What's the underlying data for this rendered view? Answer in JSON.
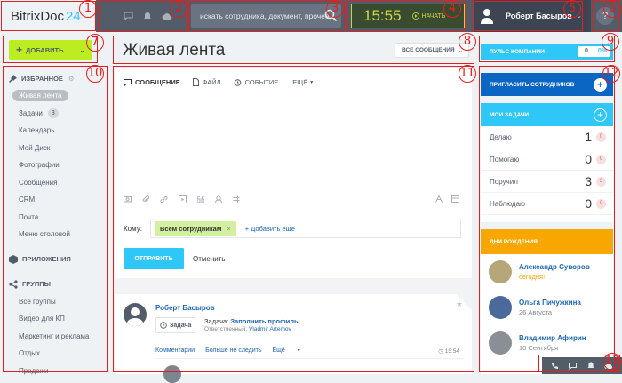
{
  "header": {
    "logo_main": "BitrixDoc",
    "logo_num": "24",
    "search_placeholder": "искать сотрудника, документ, прочее...",
    "clock_time": "15:55",
    "clock_start": "НАЧАТЬ",
    "user_name": "Роберт Басыров",
    "help": "?"
  },
  "add_button": {
    "label": "ДОБАВИТЬ",
    "plus": "+",
    "chevron": "⌄"
  },
  "sidebar": {
    "favorites_title": "ИЗБРАННОЕ",
    "favorites": [
      {
        "label": "Живая лента"
      },
      {
        "label": "Задачи",
        "badge": "3"
      },
      {
        "label": "Календарь"
      },
      {
        "label": "Мой Диск"
      },
      {
        "label": "Фотографии"
      },
      {
        "label": "Сообщения"
      },
      {
        "label": "CRM"
      },
      {
        "label": "Почта"
      },
      {
        "label": "Меню столовой"
      }
    ],
    "apps_title": "ПРИЛОЖЕНИЯ",
    "groups_title": "ГРУППЫ",
    "groups": [
      {
        "label": "Все группы"
      },
      {
        "label": "Видео для КП"
      },
      {
        "label": "Маркетинг и реклама"
      },
      {
        "label": "Отдых"
      },
      {
        "label": "Продажи"
      }
    ]
  },
  "main": {
    "title": "Живая лента",
    "filter": "ВСЕ СООБЩЕНИЯ",
    "filter_chevron": "⌄",
    "tabs": {
      "message": "СООБЩЕНИЕ",
      "file": "ФАЙЛ",
      "event": "СОБЫТИЕ",
      "more": "ЕЩЁ"
    },
    "to_label": "Кому:",
    "recipient": "Всем сотрудникам",
    "recipient_remove": "×",
    "add_more": "+ Добавить еще",
    "send": "ОТПРАВИТЬ",
    "cancel": "Отменить",
    "post": {
      "author": "Роберт Басыров",
      "type": "Задача",
      "task_prefix": "Задача:",
      "task_link": "Заполнить профиль",
      "resp_prefix": "Ответственный:",
      "resp_name": "Vladmir Artemov",
      "action_comments": "Комментарии",
      "action_unfollow": "Больше не следить",
      "action_more": "Ещё",
      "time": "15:54"
    }
  },
  "right": {
    "pulse_label": "ПУЛЬС КОМПАНИИ",
    "pulse_count": "0",
    "pulse_pct": "0%",
    "invite": "ПРИГЛАСИТЬ СОТРУДНИКОВ",
    "tasks_title": "МОИ ЗАДАЧИ",
    "tasks": [
      {
        "label": "Делаю",
        "count": "1",
        "badge": "0"
      },
      {
        "label": "Помогаю",
        "count": "0",
        "badge": "0"
      },
      {
        "label": "Поручил",
        "count": "3",
        "badge": "3"
      },
      {
        "label": "Наблюдаю",
        "count": "0",
        "badge": "0"
      }
    ],
    "birthdays_title": "ДНИ РОЖДЕНИЯ",
    "birthdays": [
      {
        "name": "Александр Суворов",
        "date": "сегодня!"
      },
      {
        "name": "Ольга Пичужкина",
        "date": "26 Августа"
      },
      {
        "name": "Владимир Афирин",
        "date": "10 Сентября"
      }
    ]
  },
  "markers": [
    "1",
    "2",
    "3",
    "4",
    "5",
    "6",
    "7",
    "8",
    "9",
    "10",
    "11",
    "12",
    "13"
  ],
  "colors": {
    "topbar": "#535c69",
    "accent_blue": "#2fc7f7",
    "add_green": "#bbed21",
    "marker_red": "#e0201e",
    "birthday_orange": "#f7a700"
  }
}
